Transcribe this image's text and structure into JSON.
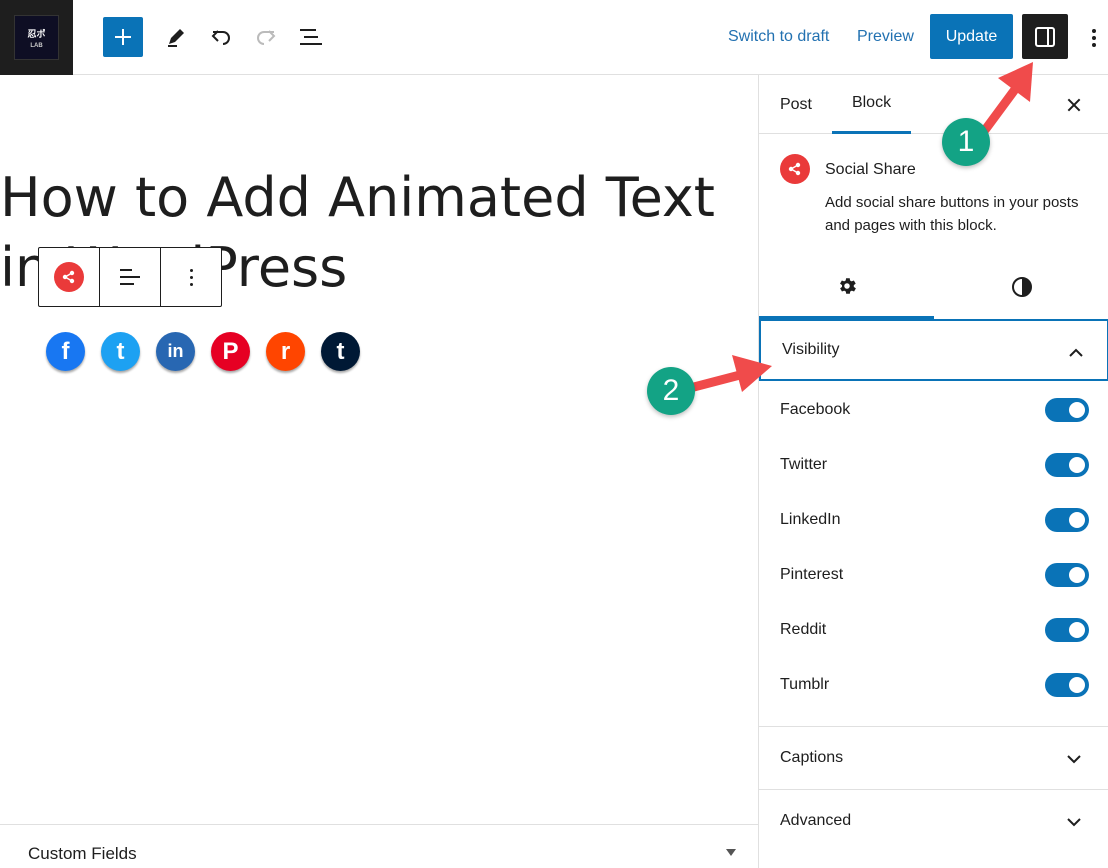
{
  "topbar": {
    "site_logo_text": "忍ポ",
    "site_logo_subtext": "LAB",
    "switch_to_draft": "Switch to draft",
    "preview": "Preview",
    "update": "Update"
  },
  "editor": {
    "post_title": "How to Add Animated Text in WordPress",
    "social_buttons": [
      {
        "name": "facebook",
        "glyph": "f",
        "color": "#1877f2"
      },
      {
        "name": "twitter",
        "glyph": "t",
        "color": "#1da1f2"
      },
      {
        "name": "linkedin",
        "glyph": "in",
        "color": "#2867b2"
      },
      {
        "name": "pinterest",
        "glyph": "P",
        "color": "#e60023"
      },
      {
        "name": "reddit",
        "glyph": "r",
        "color": "#ff4500"
      },
      {
        "name": "tumblr",
        "glyph": "t",
        "color": "#001935"
      }
    ],
    "custom_fields_label": "Custom Fields"
  },
  "sidebar": {
    "tabs": {
      "post": "Post",
      "block": "Block"
    },
    "block_card": {
      "title": "Social Share",
      "description": "Add social share buttons in your posts and pages with this block."
    },
    "visibility": {
      "label": "Visibility",
      "items": [
        {
          "label": "Facebook",
          "enabled": true
        },
        {
          "label": "Twitter",
          "enabled": true
        },
        {
          "label": "LinkedIn",
          "enabled": true
        },
        {
          "label": "Pinterest",
          "enabled": true
        },
        {
          "label": "Reddit",
          "enabled": true
        },
        {
          "label": "Tumblr",
          "enabled": true
        }
      ]
    },
    "captions_label": "Captions",
    "advanced_label": "Advanced"
  },
  "annotations": {
    "badge_1": "1",
    "badge_2": "2"
  },
  "colors": {
    "accent": "#0a73b7",
    "share_icon": "#ea3a3a",
    "badge": "#13a385",
    "arrow": "#f04b4b"
  }
}
